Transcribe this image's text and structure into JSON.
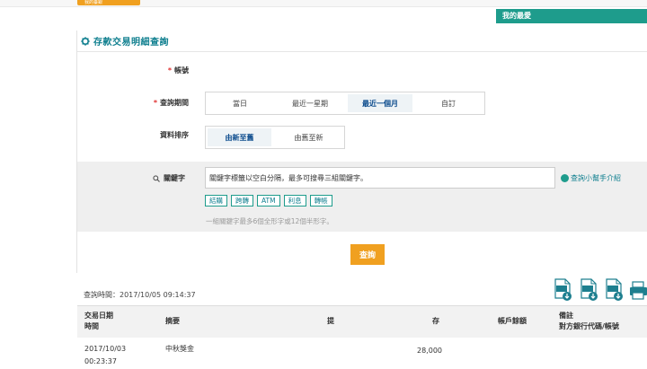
{
  "header": {
    "top_button": "我的臺銀",
    "favorites": "我的最愛"
  },
  "section": {
    "title": "存款交易明細查詢"
  },
  "form": {
    "account_label": "帳號",
    "period_label": "查詢期間",
    "period_options": [
      "當日",
      "最近一星期",
      "最近一個月",
      "自訂"
    ],
    "period_selected": "最近一個月",
    "sort_label": "資料排序",
    "sort_options": [
      "由新至舊",
      "由舊至新"
    ],
    "sort_selected": "由新至舊",
    "keyword_label": "關鍵字",
    "keyword_value": "關鍵字標籤以空白分隔，最多可搜尋三組關鍵字。",
    "help_link": "查詢小幫手介紹",
    "tags": [
      "結購",
      "跨轉",
      "ATM",
      "利息",
      "轉帳"
    ],
    "hint": "一組關鍵字最多6個全形字或12個半形字。",
    "query_button": "查詢"
  },
  "results": {
    "query_time": "查詢時間：2017/10/05 09:14:37",
    "download_icons": [
      "ods-download-icon",
      "xls-download-icon",
      "html-download-icon",
      "print-icon"
    ],
    "columns": {
      "date_1": "交易日期",
      "date_2": "時間",
      "summary": "摘要",
      "withdraw": "提",
      "deposit": "存",
      "balance": "帳戶餘額",
      "note_1": "備註",
      "note_2": "對方銀行代碼/帳號"
    },
    "rows": [
      {
        "date": "2017/10/03",
        "time": "00:23:37",
        "summary": "中秋獎金",
        "withdraw": "",
        "deposit": "28,000",
        "balance": "",
        "note": ""
      }
    ]
  },
  "colors": {
    "accent": "#1e9c8c",
    "button": "#f0a020",
    "title": "#0f7f8f"
  }
}
